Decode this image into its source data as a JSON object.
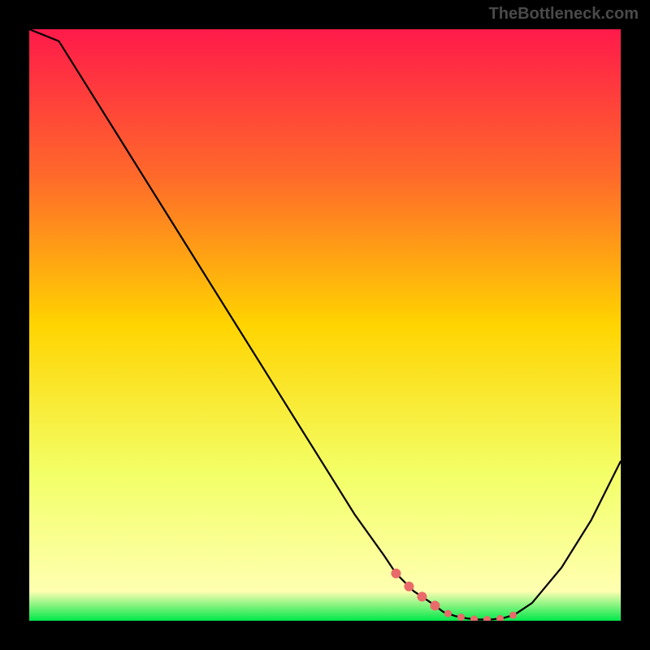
{
  "watermark": "TheBottleneck.com",
  "chart_data": {
    "type": "line",
    "title": "",
    "xlabel": "",
    "ylabel": "",
    "xlim": [
      0,
      100
    ],
    "ylim": [
      0,
      100
    ],
    "x": [
      0,
      5,
      10,
      15,
      20,
      25,
      30,
      35,
      40,
      45,
      50,
      55,
      60,
      62,
      65,
      68,
      70,
      72,
      74,
      76,
      78,
      80,
      82,
      85,
      90,
      95,
      100
    ],
    "values": [
      105,
      98,
      90,
      82,
      74,
      66,
      58,
      50,
      42,
      34,
      26,
      18,
      11,
      8,
      5,
      3,
      1.5,
      0.8,
      0.4,
      0.2,
      0.2,
      0.4,
      1.0,
      3,
      9,
      17,
      27
    ],
    "highlight_region": {
      "x_start": 62,
      "x_end": 83
    },
    "gradient_stops": [
      {
        "offset": 0,
        "color": "#ff1a4a"
      },
      {
        "offset": 25,
        "color": "#ff6a2a"
      },
      {
        "offset": 50,
        "color": "#ffd400"
      },
      {
        "offset": 75,
        "color": "#f3ff66"
      },
      {
        "offset": 95,
        "color": "#ffffb0"
      },
      {
        "offset": 100,
        "color": "#00e84a"
      }
    ]
  }
}
